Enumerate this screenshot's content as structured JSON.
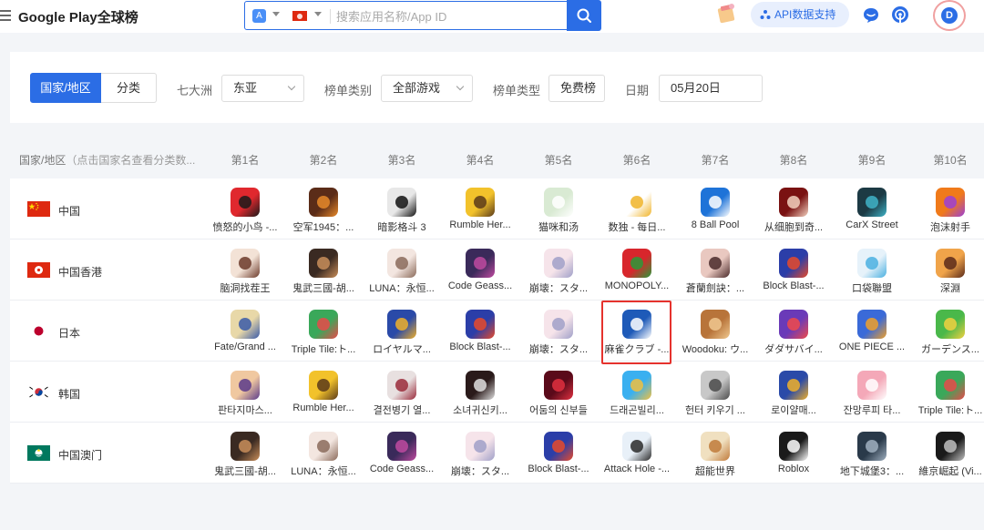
{
  "header": {
    "title": "Google Play全球榜",
    "search_placeholder": "搜索应用名称/App ID",
    "api_label": "API数据支持",
    "avatar_letter": "D",
    "store_glyph": "A"
  },
  "filters": {
    "tab_region": "国家/地区",
    "tab_category": "分类",
    "continent_label": "七大洲",
    "continent_value": "东亚",
    "chart_category_label": "榜单类别",
    "chart_category_value": "全部游戏",
    "chart_type_label": "榜单类型",
    "chart_type_value": "免费榜",
    "date_label": "日期",
    "date_value": "05月20日"
  },
  "table": {
    "country_header": "国家/地区",
    "country_hint": "（点击国家名查看分类数...",
    "rank_headers": [
      "第1名",
      "第2名",
      "第3名",
      "第4名",
      "第5名",
      "第6名",
      "第7名",
      "第8名",
      "第9名",
      "第10名"
    ],
    "rows": [
      {
        "country": "中国",
        "flag": "cn",
        "apps": [
          {
            "name": "愤怒的小鸟 -...",
            "icon": "angry-bird",
            "c1": "#e0282e",
            "c2": "#1a1a1a"
          },
          {
            "name": "空军1945：...",
            "icon": "plane",
            "c1": "#5b2c18",
            "c2": "#e88a2a"
          },
          {
            "name": "暗影格斗 3",
            "icon": "ninja",
            "c1": "#e8e8e8",
            "c2": "#111111"
          },
          {
            "name": "Rumble Her...",
            "icon": "heroes",
            "c1": "#f2c22b",
            "c2": "#5a3a1a"
          },
          {
            "name": "猫咪和汤",
            "icon": "cat",
            "c1": "#d9ead3",
            "c2": "#ffffff"
          },
          {
            "name": "数独 - 每日...",
            "icon": "sudoku",
            "c1": "#ffffff",
            "c2": "#f0b429"
          },
          {
            "name": "8 Ball Pool",
            "icon": "ball",
            "c1": "#1e73d8",
            "c2": "#ffffff"
          },
          {
            "name": "从细胞到奇...",
            "icon": "cell",
            "c1": "#7a1212",
            "c2": "#f3d2c0"
          },
          {
            "name": "CarX Street",
            "icon": "car",
            "c1": "#1c3a44",
            "c2": "#3fb4c8"
          },
          {
            "name": "泡沫射手",
            "icon": "bubble",
            "c1": "#f07a1a",
            "c2": "#9b3fd6"
          }
        ]
      },
      {
        "country": "中国香港",
        "flag": "hk",
        "apps": [
          {
            "name": "脑洞找茬王",
            "icon": "girl",
            "c1": "#f3e2d6",
            "c2": "#6b3a2a"
          },
          {
            "name": "鬼武三國-胡...",
            "icon": "warrior",
            "c1": "#3a2a22",
            "c2": "#c98e5a"
          },
          {
            "name": "LUNA：永恒...",
            "icon": "luna",
            "c1": "#f3e6e0",
            "c2": "#8a6a5a"
          },
          {
            "name": "Code Geass...",
            "icon": "geass",
            "c1": "#3a2a5a",
            "c2": "#c04aa0"
          },
          {
            "name": "崩壊：スタ...",
            "icon": "anime",
            "c1": "#f6e4ea",
            "c2": "#a0a0c8"
          },
          {
            "name": "MONOPOLY...",
            "icon": "monopoly",
            "c1": "#d8262c",
            "c2": "#2a9a3a"
          },
          {
            "name": "蒼蘭劍訣：...",
            "icon": "sword-girl",
            "c1": "#e9c8c0",
            "c2": "#4a2a2a"
          },
          {
            "name": "Block Blast-...",
            "icon": "block",
            "c1": "#2b3ea8",
            "c2": "#e84a2a"
          },
          {
            "name": "口袋聯盟",
            "icon": "pocket",
            "c1": "#e6f2fa",
            "c2": "#4ab0e0"
          },
          {
            "name": "深淵",
            "icon": "abyss",
            "c1": "#f0a44a",
            "c2": "#5a2a1a"
          }
        ]
      },
      {
        "country": "日本",
        "flag": "jp",
        "apps": [
          {
            "name": "Fate/Grand ...",
            "icon": "fate",
            "c1": "#e8d8a8",
            "c2": "#3a5aa8"
          },
          {
            "name": "Triple Tile:ト...",
            "icon": "tile",
            "c1": "#3aa85a",
            "c2": "#e84a4a"
          },
          {
            "name": "ロイヤルマ...",
            "icon": "royal",
            "c1": "#2a4aa8",
            "c2": "#f0b02a"
          },
          {
            "name": "Block Blast-...",
            "icon": "block",
            "c1": "#2b3ea8",
            "c2": "#e84a2a"
          },
          {
            "name": "崩壊：スタ...",
            "icon": "anime",
            "c1": "#f6e4ea",
            "c2": "#a0a0c8"
          },
          {
            "name": "麻雀クラブ -...",
            "icon": "mahjong",
            "c1": "#1e5ab8",
            "c2": "#ffffff"
          },
          {
            "name": "Woodoku: ウ...",
            "icon": "wood",
            "c1": "#b8743a",
            "c2": "#f0c890"
          },
          {
            "name": "ダダサバイ...",
            "icon": "survivor",
            "c1": "#6a3ab8",
            "c2": "#f04a4a"
          },
          {
            "name": "ONE PIECE ...",
            "icon": "onepiece",
            "c1": "#3a6ad8",
            "c2": "#f0a02a"
          },
          {
            "name": "ガーデンス...",
            "icon": "garden",
            "c1": "#4ab84a",
            "c2": "#f0d040"
          }
        ]
      },
      {
        "country": "韩国",
        "flag": "kr",
        "apps": [
          {
            "name": "판타지마스...",
            "icon": "fantasy",
            "c1": "#f0c8a0",
            "c2": "#5a3a8a"
          },
          {
            "name": "Rumble Her...",
            "icon": "heroes",
            "c1": "#f2c22b",
            "c2": "#5a3a1a"
          },
          {
            "name": "결전병기 열...",
            "icon": "weapon",
            "c1": "#e8e0e0",
            "c2": "#9a2a3a"
          },
          {
            "name": "소녀귀신키...",
            "icon": "ghost-girl",
            "c1": "#2a1a1a",
            "c2": "#e0e0e0"
          },
          {
            "name": "어둠의 신부들",
            "icon": "bride",
            "c1": "#5a0a1a",
            "c2": "#e03040"
          },
          {
            "name": "드래곤빌리...",
            "icon": "dragon",
            "c1": "#3ab0f0",
            "c2": "#f0c040"
          },
          {
            "name": "헌터 키우기 ...",
            "icon": "hunter",
            "c1": "#c8c8c8",
            "c2": "#4a4a4a"
          },
          {
            "name": "로이얄매...",
            "icon": "royal",
            "c1": "#2a4aa8",
            "c2": "#f0b02a"
          },
          {
            "name": "잔망루피 타...",
            "icon": "loopy",
            "c1": "#f4a8b8",
            "c2": "#ffffff"
          },
          {
            "name": "Triple Tile:ト...",
            "icon": "tile",
            "c1": "#3aa85a",
            "c2": "#e84a4a"
          }
        ]
      },
      {
        "country": "中国澳门",
        "flag": "mo",
        "apps": [
          {
            "name": "鬼武三國-胡...",
            "icon": "warrior",
            "c1": "#3a2a22",
            "c2": "#c98e5a"
          },
          {
            "name": "LUNA：永恒...",
            "icon": "luna",
            "c1": "#f3e6e0",
            "c2": "#8a6a5a"
          },
          {
            "name": "Code Geass...",
            "icon": "geass",
            "c1": "#3a2a5a",
            "c2": "#c04aa0"
          },
          {
            "name": "崩壊：スタ...",
            "icon": "anime",
            "c1": "#f6e4ea",
            "c2": "#a0a0c8"
          },
          {
            "name": "Block Blast-...",
            "icon": "block",
            "c1": "#2b3ea8",
            "c2": "#e84a2a"
          },
          {
            "name": "Attack Hole -...",
            "icon": "hole",
            "c1": "#e8f0f8",
            "c2": "#2a2a2a"
          },
          {
            "name": "超能世界",
            "icon": "super",
            "c1": "#f0e0c0",
            "c2": "#c07a3a"
          },
          {
            "name": "Roblox",
            "icon": "roblox",
            "c1": "#1a1a1a",
            "c2": "#ffffff"
          },
          {
            "name": "地下城堡3：...",
            "icon": "dungeon",
            "c1": "#2a3a4a",
            "c2": "#a0b0c0"
          },
          {
            "name": "維京崛起 (Vi...",
            "icon": "viking",
            "c1": "#1a1a1a",
            "c2": "#c0c0c0"
          }
        ]
      }
    ]
  },
  "colors": {
    "accent": "#2b6de5",
    "highlight": "#e5322d"
  }
}
